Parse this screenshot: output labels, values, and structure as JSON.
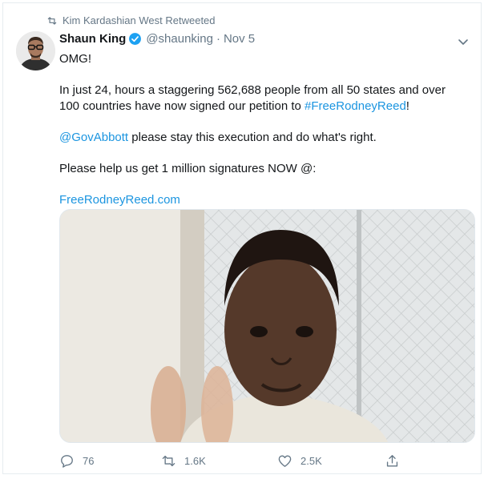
{
  "retweet_context": {
    "text": "Kim Kardashian West Retweeted"
  },
  "author": {
    "display_name": "Shaun King",
    "handle": "@shaunking",
    "separator": "·",
    "date": "Nov 5"
  },
  "tweet": {
    "line1": "OMG!",
    "para1_before": "In just 24, hours a staggering 562,688 people from all 50 states and over 100 countries have now signed our petition to ",
    "para1_hashtag": "#FreeRodneyReed",
    "para1_after": "!",
    "para2_mention": "@GovAbbott",
    "para2_rest": " please stay this execution and do what's right.",
    "para3": "Please help us get 1 million signatures NOW @:",
    "link": "FreeRodneyReed.com"
  },
  "actions": {
    "replies": "76",
    "retweets": "1.6K",
    "likes": "2.5K"
  },
  "colors": {
    "link": "#1b95e0",
    "secondary_text": "#657786",
    "verified": "#1da1f2"
  },
  "icons": [
    "retweet-icon",
    "verified-icon",
    "caret-down-icon",
    "reply-icon",
    "like-icon",
    "share-icon"
  ]
}
